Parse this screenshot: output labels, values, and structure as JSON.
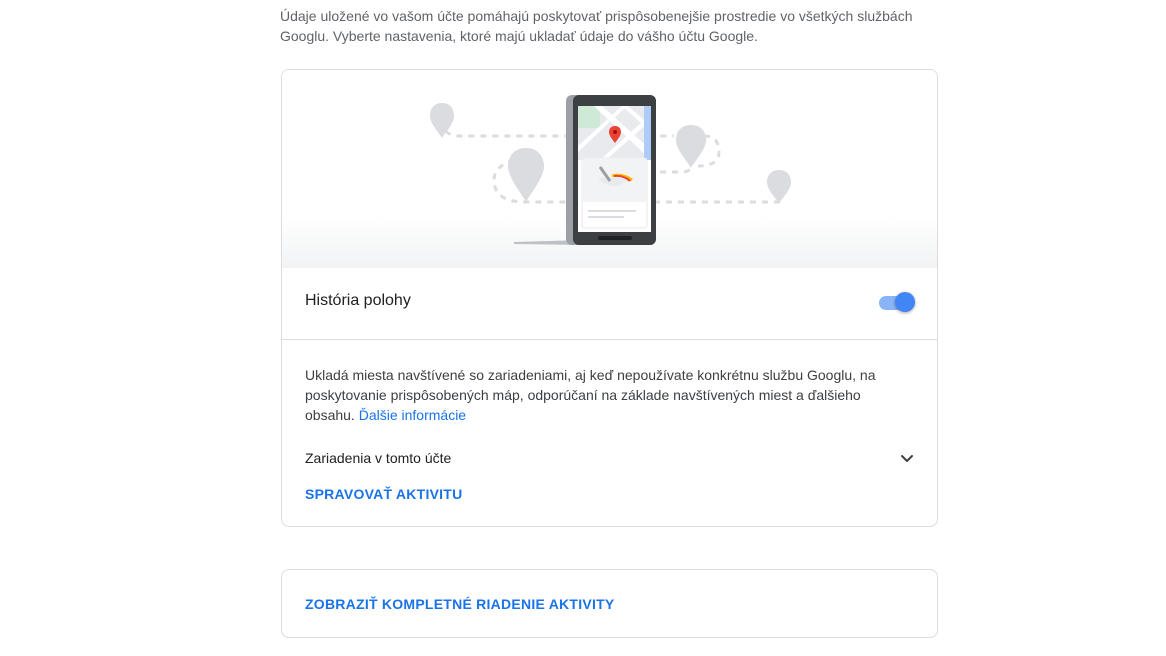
{
  "intro": {
    "text": "Údaje uložené vo vašom účte pomáhajú poskytovať prispôsobenejšie prostredie vo všetkých službách Googlu. Vyberte nastavenia, ktoré majú ukladať údaje do vášho účtu Google."
  },
  "location_history": {
    "title": "História polohy",
    "toggle_state": "on",
    "description": "Ukladá miesta navštívené so zariadeniami, aj keď nepoužívate konkrétnu službu Googlu, na poskytovanie prispôsobených máp, odporúčaní na základe navštívených miest a ďalšieho obsahu.",
    "learn_more": "Ďalšie informácie",
    "devices_label": "Zariadenia v tomto účte",
    "manage_button": "SPRAVOVAŤ AKTIVITU"
  },
  "footer_card": {
    "button": "ZOBRAZIŤ KOMPLETNÉ RIADENIE AKTIVITY"
  },
  "icons": {
    "devices_expand": "chevron-down-icon",
    "illustration": "phone-map-illustration"
  },
  "colors": {
    "accent": "#1a73e8",
    "toggle_track": "#8ab4f8",
    "toggle_knob": "#4285f4",
    "map_pin": "#ea4335",
    "border": "#dadce0"
  }
}
